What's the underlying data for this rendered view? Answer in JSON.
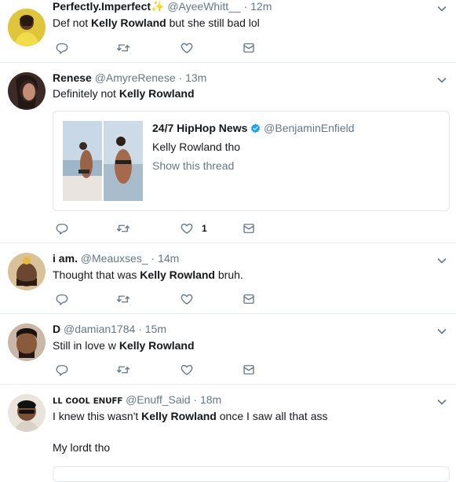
{
  "tweets": [
    {
      "name": "Perfectly.Imperfect",
      "emoji": "✨",
      "handle": "@AyeeWhitt__",
      "dot": "·",
      "time": "12m",
      "text_pre": "Def not ",
      "text_bold": "Kelly Rowland",
      "text_post": " but she still bad lol",
      "likes": ""
    },
    {
      "name": "Renese",
      "handle": "@AmyreRenese",
      "dot": "·",
      "time": "13m",
      "text_pre": "Definitely not ",
      "text_bold": "Kelly Rowland",
      "text_post": "",
      "likes": "1",
      "quote": {
        "name": "24/7 HipHop News",
        "handle": "@BenjaminEnfield",
        "text": "Kelly Rowland tho",
        "link": "Show this thread"
      }
    },
    {
      "name": "i am.",
      "handle": "@Meauxses_",
      "dot": "·",
      "time": "14m",
      "text_pre": "Thought that was ",
      "text_bold": "Kelly Rowland",
      "text_post": " bruh.",
      "likes": ""
    },
    {
      "name": "D",
      "handle": "@damian1784",
      "dot": "·",
      "time": "15m",
      "text_pre": "Still in love w ",
      "text_bold": "Kelly Rowland",
      "text_post": "",
      "likes": ""
    },
    {
      "name": "ʟʟ ᴄᴏᴏʟ ᴇɴᴜꜰꜰ",
      "handle": "@Enuff_Said",
      "dot": "·",
      "time": "18m",
      "text_pre": "I knew this wasn't ",
      "text_bold": "Kelly Rowland",
      "text_post": " once I saw all that ass",
      "line2": "My lordt tho"
    }
  ],
  "icons": {
    "reply": "reply-icon",
    "retweet": "retweet-icon",
    "like": "heart-icon",
    "message": "envelope-icon",
    "caret": "chevron-down-icon",
    "verified": "verified-badge-icon"
  },
  "colors": {
    "verified": "#1da1f2",
    "muted": "#657786",
    "border": "#e6ecf0"
  }
}
